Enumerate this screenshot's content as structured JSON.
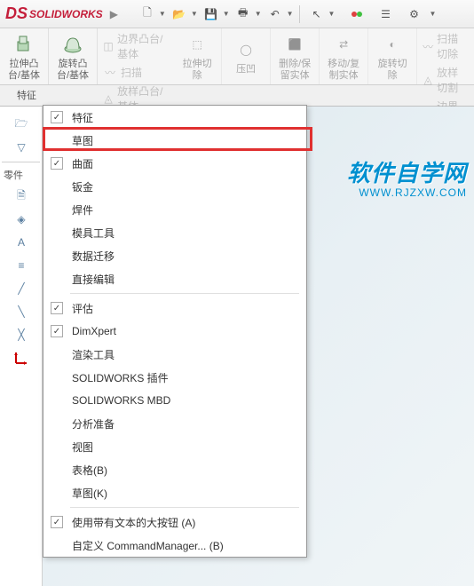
{
  "app": {
    "logo_prefix": "DS",
    "logo_text": "SOLIDWORKS"
  },
  "toolbar": {
    "extrude_boss": "拉伸凸\n台/基体",
    "revolve_boss": "旋转凸\n台/基体",
    "boundary_boss": "边界凸台/基体",
    "sweep": "扫描",
    "loft_boss": "放样凸台/基体",
    "extrude_cut": "拉伸切\n除",
    "hole": "压凹",
    "delete_keep": "删除/保\n留实体",
    "move_copy": "移动/复\n制实体",
    "revolve_cut": "旋转切\n除",
    "sweep_cut": "扫描切除",
    "loft_cut": "放样切割",
    "boundary_cut": "边界切除"
  },
  "tabs": {
    "features": "特征"
  },
  "left": {
    "part": "零件"
  },
  "context_menu": {
    "items": [
      {
        "label": "特征",
        "checked": true
      },
      {
        "label": "草图",
        "checked": false,
        "highlight": true
      },
      {
        "label": "曲面",
        "checked": true
      },
      {
        "label": "钣金",
        "checked": false
      },
      {
        "label": "焊件",
        "checked": false
      },
      {
        "label": "模具工具",
        "checked": false
      },
      {
        "label": "数据迁移",
        "checked": false
      },
      {
        "label": "直接编辑",
        "checked": false
      },
      {
        "label": "评估",
        "checked": true,
        "sep_before": true
      },
      {
        "label": "DimXpert",
        "checked": true
      },
      {
        "label": "渲染工具",
        "checked": false
      },
      {
        "label": "SOLIDWORKS 插件",
        "checked": false
      },
      {
        "label": "SOLIDWORKS MBD",
        "checked": false
      },
      {
        "label": "分析准备",
        "checked": false
      },
      {
        "label": "视图",
        "checked": false
      },
      {
        "label": "表格(B)",
        "checked": false
      },
      {
        "label": "草图(K)",
        "checked": false
      },
      {
        "label": "使用带有文本的大按钮 (A)",
        "checked": true,
        "sep_before": true
      },
      {
        "label": "自定义 CommandManager... (B)",
        "checked": false
      }
    ]
  },
  "watermark": {
    "main": "软件自学网",
    "sub": "WWW.RJZXW.COM"
  }
}
